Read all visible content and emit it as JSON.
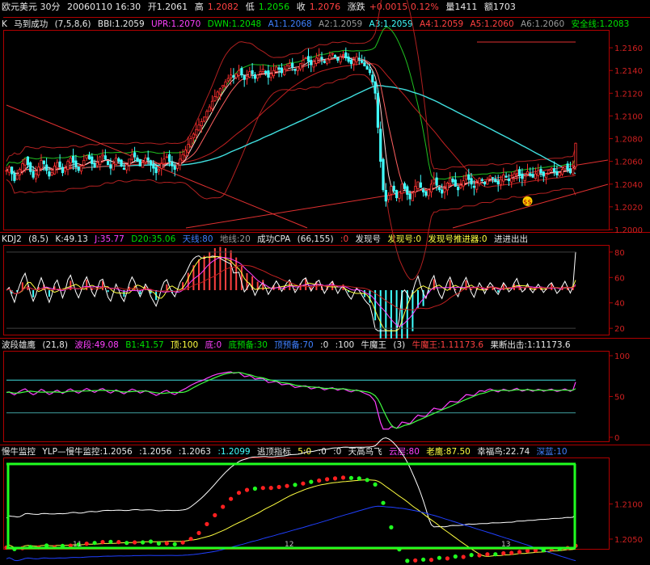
{
  "title_bar": {
    "symbol": "欧元美元 30分",
    "datetime": "20060110 16:30",
    "open": "开1.2061",
    "high_label": "高",
    "high": "1.2082",
    "low_label": "低",
    "low": "1.2056",
    "close_label": "收",
    "close": "1.2076",
    "change_label": "涨跌",
    "change": "+0.0015 0.12%",
    "volume": "量1411",
    "amount": "额1703"
  },
  "colors": {
    "up": "#ff3030",
    "down": "#40ffff",
    "axis": "#b00000",
    "green": "#20ff20"
  },
  "panels": {
    "main": {
      "header": {
        "k": "K",
        "name": "马到成功",
        "params": "(7,5,8,6)",
        "bbi": "BBI:1.2059",
        "upr": "UPR:1.2070",
        "dwn": "DWN:1.2048",
        "a1": "A1:1.2068",
        "a2": "A2:1.2059",
        "a3": "A3:1.2059",
        "a4": "A4:1.2059",
        "a5": "A5:1.2060",
        "a6": "A6:1.2060",
        "safe": "安全线:1.2083"
      },
      "axis_ticks": [
        "1.2160",
        "1.2140",
        "1.2120",
        "1.2100",
        "1.2080",
        "1.2060",
        "1.2040",
        "1.2020",
        "1.2000"
      ],
      "badge": "$$"
    },
    "kdj": {
      "header": {
        "name": "KDJ2",
        "params": "(8,5)",
        "k": "K:49.13",
        "j": "J:35.77",
        "d20": "D20:35.06",
        "tian": "天线:80",
        "di": "地线:20",
        "cpa": "成功CPA",
        "cpa_params": "(66,155)",
        "cpa_zero": ":0",
        "faxian": "发现号",
        "faxian_val": "发现号:0",
        "tuijin": "发现号推进器:0",
        "jinchu": "进进出出"
      },
      "axis_ticks": [
        "80",
        "60",
        "40",
        "20"
      ]
    },
    "wave": {
      "header": {
        "name": "波段雄鹰",
        "params": "(21,8)",
        "bd": "波段:49.08",
        "b1": "B1:41.57",
        "top": "顶:100",
        "bottom": "底:0",
        "dyb": "底预备:30",
        "dingyb": "顶预备:70",
        "z": ":0",
        "h": ":100",
        "nmw": "牛魔王",
        "nmw_params": "(3)",
        "nmw_val": "牛魔王:1.11173.6",
        "gd": "果断出击:1:11173.6"
      },
      "axis_ticks": [
        "100",
        "50",
        "0"
      ]
    },
    "bull": {
      "header": {
        "name": "慢牛监控",
        "ylp": "YLP—慢牛监控:1.2056",
        "v2": ":1.2056",
        "v3": ":1.2063",
        "v4": ":1.2099",
        "escape": "逃顶指标",
        "esc_params": "5:0",
        "e1": ":0",
        "e2": ":0",
        "tgnf": "天高鸟飞",
        "cloud": "云层:80",
        "eagle": "老鹰:87.50",
        "bird": "幸福鸟:22.74",
        "deep": "深蓝:10"
      },
      "axis_ticks": [
        "1.2100",
        "1.2050"
      ],
      "date_marks": [
        "11",
        "12",
        "13"
      ]
    }
  },
  "chart_data": {
    "type": "candlestick",
    "title": "欧元美元 30分",
    "ylim": [
      1.2,
      1.2175
    ],
    "close": [
      1.2052,
      1.2055,
      1.2049,
      1.2043,
      1.2048,
      1.2053,
      1.2058,
      1.2062,
      1.2057,
      1.2051,
      1.2046,
      1.2049,
      1.2055,
      1.2061,
      1.2058,
      1.2052,
      1.2047,
      1.205,
      1.2056,
      1.2059,
      1.2055,
      1.205,
      1.2054,
      1.206,
      1.2063,
      1.2059,
      1.2055,
      1.2052,
      1.2056,
      1.2061,
      1.2065,
      1.2062,
      1.2058,
      1.2055,
      1.2059,
      1.2064,
      1.2066,
      1.2062,
      1.2057,
      1.2054,
      1.2058,
      1.2063,
      1.206,
      1.2056,
      1.2053,
      1.2057,
      1.2062,
      1.2066,
      1.2064,
      1.206,
      1.2056,
      1.2059,
      1.2063,
      1.2061,
      1.2057,
      1.2054,
      1.205,
      1.2053,
      1.2058,
      1.2062,
      1.2064,
      1.206,
      1.2056,
      1.2053,
      1.2057,
      1.2062,
      1.2066,
      1.207,
      1.2075,
      1.208,
      1.2084,
      1.2088,
      1.2092,
      1.2095,
      1.2099,
      1.2104,
      1.2108,
      1.2113,
      1.2117,
      1.2121,
      1.2124,
      1.2127,
      1.213,
      1.2133,
      1.2136,
      1.2134,
      1.2137,
      1.214,
      1.2136,
      1.2132,
      1.2135,
      1.2139,
      1.2137,
      1.2133,
      1.2136,
      1.2139,
      1.2141,
      1.2138,
      1.2134,
      1.2137,
      1.214,
      1.2143,
      1.2141,
      1.2138,
      1.2141,
      1.2144,
      1.2146,
      1.2143,
      1.214,
      1.2143,
      1.2146,
      1.2149,
      1.2151,
      1.2148,
      1.2145,
      1.2148,
      1.2151,
      1.2153,
      1.215,
      1.2147,
      1.215,
      1.2153,
      1.2155,
      1.2152,
      1.2149,
      1.2152,
      1.2154,
      1.2151,
      1.2148,
      1.2146,
      1.2149,
      1.2152,
      1.215,
      1.2147,
      1.2144,
      1.2141,
      1.2138,
      1.213,
      1.212,
      1.209,
      1.206,
      1.2035,
      1.2025,
      1.203,
      1.2038,
      1.2034,
      1.2028,
      1.2033,
      1.204,
      1.2036,
      1.2031,
      1.2027,
      1.2032,
      1.2038,
      1.2042,
      1.2037,
      1.2033,
      1.203,
      1.2035,
      1.204,
      1.2044,
      1.2039,
      1.2035,
      1.2032,
      1.2036,
      1.2041,
      1.2045,
      1.2042,
      1.2038,
      1.2035,
      1.2039,
      1.2043,
      1.2047,
      1.2044,
      1.204,
      1.2037,
      1.2041,
      1.2045,
      1.2043,
      1.204,
      1.2044,
      1.2047,
      1.2045,
      1.2042,
      1.204,
      1.2044,
      1.2048,
      1.2046,
      1.2043,
      1.2045,
      1.2049,
      1.2052,
      1.2048,
      1.2045,
      1.2047,
      1.2051,
      1.2048,
      1.2046,
      1.2049,
      1.2052,
      1.205,
      1.2047,
      1.2049,
      1.2052,
      1.2054,
      1.2051,
      1.2048,
      1.205,
      1.2053,
      1.2056,
      1.2053,
      1.205,
      1.2054,
      1.2076
    ]
  }
}
